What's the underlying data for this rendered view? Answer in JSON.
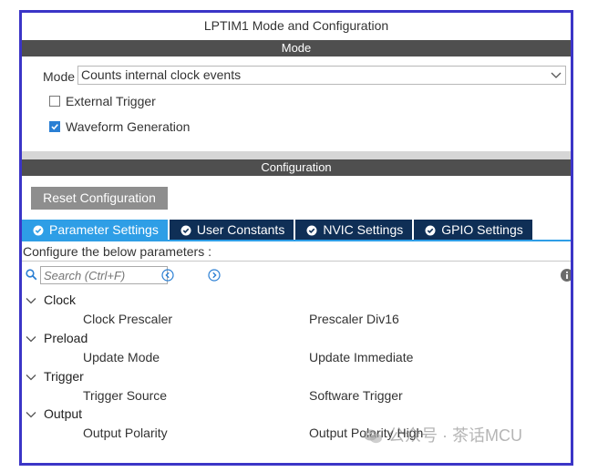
{
  "window": {
    "title": "LPTIM1 Mode and Configuration"
  },
  "mode_section": {
    "header": "Mode",
    "mode_label": "Mode",
    "mode_value": "Counts internal clock events",
    "external_trigger": {
      "label": "External Trigger",
      "checked": false
    },
    "waveform_generation": {
      "label": "Waveform Generation",
      "checked": true
    }
  },
  "config_section": {
    "header": "Configuration",
    "reset_button": "Reset Configuration",
    "tabs": [
      {
        "label": "Parameter Settings",
        "active": true
      },
      {
        "label": "User Constants",
        "active": false
      },
      {
        "label": "NVIC Settings",
        "active": false
      },
      {
        "label": "GPIO Settings",
        "active": false
      }
    ],
    "instructions": "Configure the below parameters :",
    "search": {
      "placeholder": "Search (Ctrl+F)"
    }
  },
  "tree": {
    "groups": [
      {
        "label": "Clock",
        "param": "Clock Prescaler",
        "value": "Prescaler Div16"
      },
      {
        "label": "Preload",
        "param": "Update Mode",
        "value": "Update Immediate"
      },
      {
        "label": "Trigger",
        "param": "Trigger Source",
        "value": "Software Trigger"
      },
      {
        "label": "Output",
        "param": "Output Polarity",
        "value": "Output Polarity High"
      }
    ]
  },
  "watermark": {
    "text": "公众号 · 茶话MCU"
  },
  "colors": {
    "frame_border": "#3b35c7",
    "section_bar": "#4f4f4f",
    "tab_active": "#2e9ee6",
    "tab_inactive": "#0f2f56",
    "button_gray": "#8e8e8e",
    "check_blue": "#2a7fd4"
  },
  "icons": {
    "dropdown": "chevron-down-icon",
    "tab_status": "check-circle-icon",
    "search": "search-icon",
    "prev": "chevron-left-circle-icon",
    "next": "chevron-right-circle-icon",
    "info": "info-icon",
    "tree_expand": "chevron-down-icon"
  }
}
